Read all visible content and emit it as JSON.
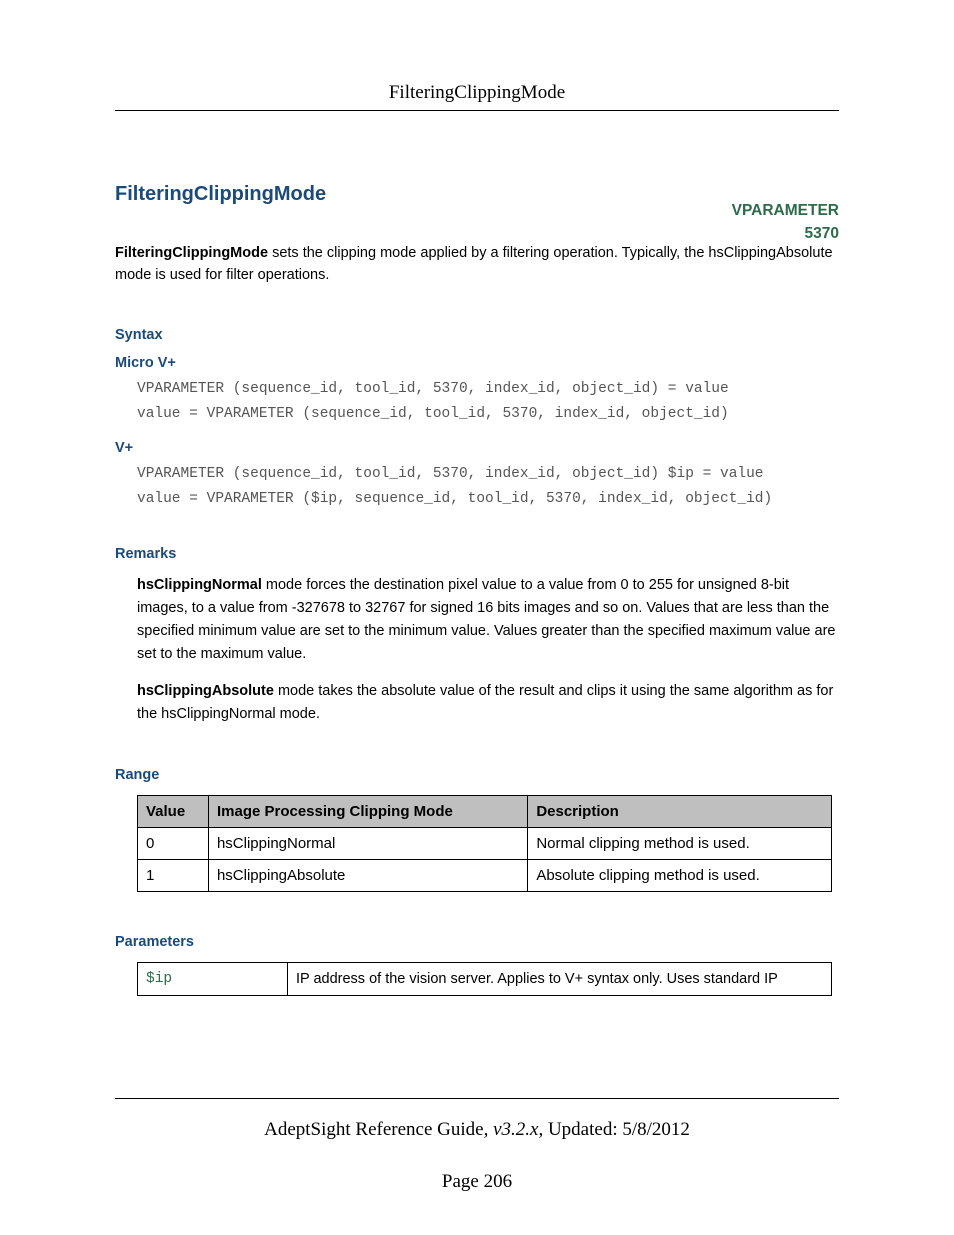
{
  "header": {
    "title": "FilteringClippingMode"
  },
  "title": "FilteringClippingMode",
  "vparam": {
    "label": "VPARAMETER",
    "number": "5370"
  },
  "intro": {
    "bold": "FilteringClippingMode",
    "rest": " sets the clipping mode applied by a filtering operation. Typically, the hsClippingAbsolute mode is used for filter operations."
  },
  "syntax": {
    "heading": "Syntax",
    "micro_label": "Micro V+",
    "micro_code": "VPARAMETER (sequence_id, tool_id, 5370, index_id, object_id) = value\nvalue = VPARAMETER (sequence_id, tool_id, 5370, index_id, object_id)",
    "vplus_label": "V+",
    "vplus_code": "VPARAMETER (sequence_id, tool_id, 5370, index_id, object_id) $ip = value\nvalue = VPARAMETER ($ip, sequence_id, tool_id, 5370, index_id, object_id)"
  },
  "remarks": {
    "heading": "Remarks",
    "p1_bold": "hsClippingNormal",
    "p1_rest": " mode forces the destination pixel value to a value from 0 to 255 for unsigned 8-bit images, to a value from -327678 to 32767 for signed 16 bits images and so on. Values that are less than the specified minimum value are set to the minimum value. Values greater than the specified maximum value are set to the maximum value.",
    "p2_bold": "hsClippingAbsolute",
    "p2_rest": " mode takes the absolute value of the result and clips it using the same algorithm as for the hsClippingNormal mode."
  },
  "range": {
    "heading": "Range",
    "headers": [
      "Value",
      "Image Processing Clipping Mode",
      "Description"
    ],
    "rows": [
      [
        "0",
        "hsClippingNormal",
        "Normal clipping method is used."
      ],
      [
        "1",
        "hsClippingAbsolute",
        "Absolute clipping method is used."
      ]
    ]
  },
  "parameters": {
    "heading": "Parameters",
    "rows": [
      {
        "name": "$ip",
        "desc": "IP address of the vision server. Applies to V+ syntax only. Uses standard IP"
      }
    ]
  },
  "footer": {
    "guide": "AdeptSight Reference Guide",
    "version": ", v3.2.x",
    "updated": ", Updated: 5/8/2012",
    "page": "Page 206"
  }
}
